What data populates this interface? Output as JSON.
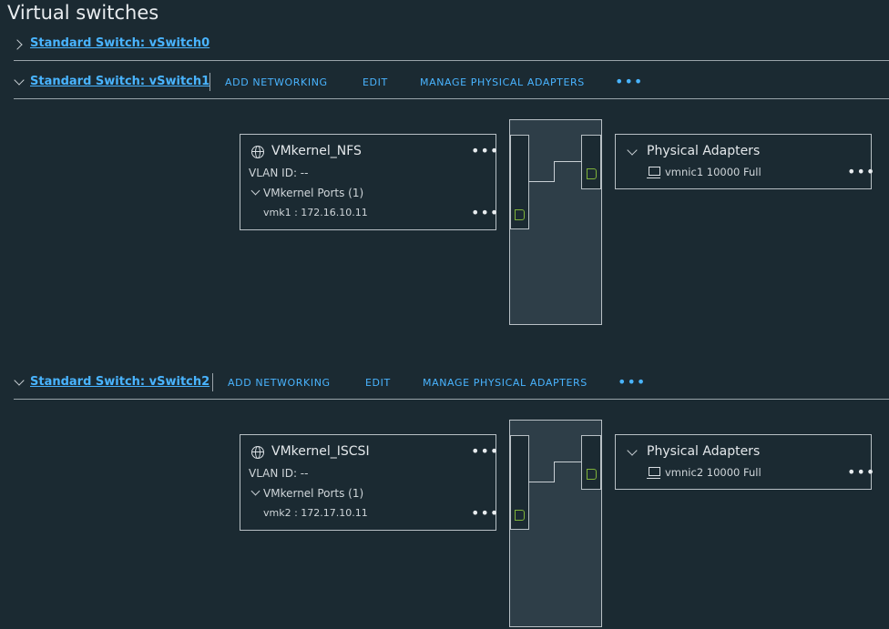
{
  "page": {
    "title": "Virtual switches"
  },
  "switches": [
    {
      "link": "Standard Switch: vSwitch0"
    },
    {
      "link": "Standard Switch: vSwitch1",
      "actions": [
        "ADD NETWORKING",
        "EDIT",
        "MANAGE PHYSICAL ADAPTERS"
      ],
      "portgroup": {
        "name": "VMkernel_NFS",
        "vlan": "VLAN ID: --",
        "ports_label": "VMkernel Ports (1)",
        "port": "vmk1 : 172.16.10.11"
      },
      "adapters": {
        "title": "Physical Adapters",
        "nic": "vmnic1 10000 Full"
      }
    },
    {
      "link": "Standard Switch: vSwitch2",
      "actions": [
        "ADD NETWORKING",
        "EDIT",
        "MANAGE PHYSICAL ADAPTERS"
      ],
      "portgroup": {
        "name": "VMkernel_ISCSI",
        "vlan": "VLAN ID: --",
        "ports_label": "VMkernel Ports (1)",
        "port": "vmk2 : 172.17.10.11"
      },
      "adapters": {
        "title": "Physical Adapters",
        "nic": "vmnic2 10000 Full"
      }
    }
  ],
  "icons": {
    "more": "•••",
    "portgroup": "globe-icon",
    "nic": "network-adapter-icon",
    "port": "port-connector-icon"
  },
  "colors": {
    "background": "#1b2a32",
    "link": "#49b4ff",
    "port_green": "#7fb23a",
    "switch_fill": "#2e3e48"
  }
}
